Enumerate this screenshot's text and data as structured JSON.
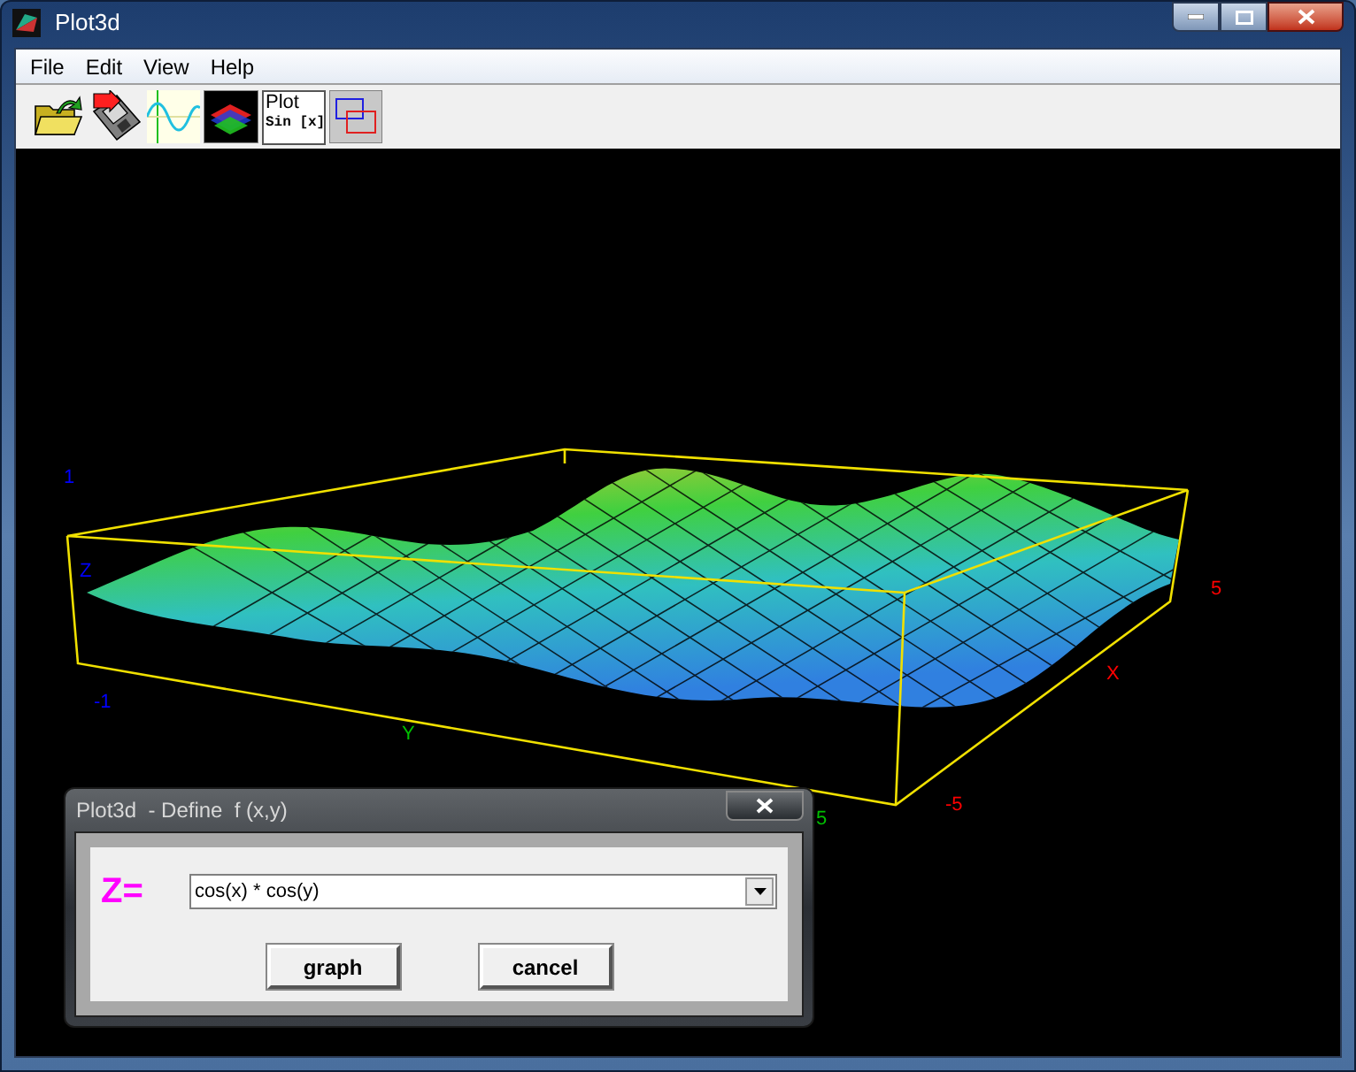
{
  "window": {
    "title": "Plot3d"
  },
  "menu": [
    "File",
    "Edit",
    "View",
    "Help"
  ],
  "toolbar": [
    {
      "kind": "open"
    },
    {
      "kind": "save"
    },
    {
      "kind": "wave"
    },
    {
      "kind": "surface"
    },
    {
      "kind": "plot",
      "label": "Plot",
      "sublabel": "Sin [x]"
    },
    {
      "kind": "windows"
    }
  ],
  "axis_labels": [
    {
      "text": "1",
      "color": "#0000ff"
    },
    {
      "text": "Z",
      "color": "#0000ff"
    },
    {
      "text": "-1",
      "color": "#0000ff"
    },
    {
      "text": "Y",
      "color": "#00c000"
    },
    {
      "text": "5",
      "color": "#ff0000"
    },
    {
      "text": "X",
      "color": "#ff0000"
    },
    {
      "text": "-5",
      "color": "#ff0000"
    },
    {
      "text": "5",
      "color": "#00c000"
    }
  ],
  "dialog": {
    "title": "Plot3d  - Define  f (x,y)",
    "label": "Z=",
    "field": {
      "value": "cos(x) * cos(y)"
    },
    "buttons": [
      "graph",
      "cancel"
    ]
  }
}
